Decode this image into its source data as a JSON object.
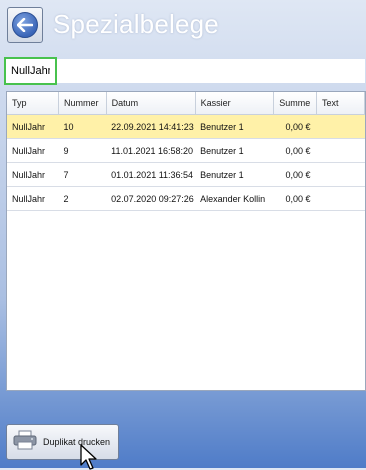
{
  "header": {
    "title": "Spezialbelege",
    "back_icon": "back-arrow-icon"
  },
  "filter": {
    "value": "NullJahr"
  },
  "table": {
    "columns": [
      "Typ",
      "Nummer",
      "Datum",
      "Kassier",
      "Summe",
      "Text"
    ],
    "rows": [
      {
        "typ": "NullJahr",
        "nummer": "10",
        "datum": "22.09.2021 14:41:23",
        "kassier": "Benutzer 1",
        "summe": "0,00 €",
        "text": "",
        "selected": true
      },
      {
        "typ": "NullJahr",
        "nummer": "9",
        "datum": "11.01.2021 16:58:20",
        "kassier": "Benutzer 1",
        "summe": "0,00 €",
        "text": ""
      },
      {
        "typ": "NullJahr",
        "nummer": "7",
        "datum": "01.01.2021 11:36:54",
        "kassier": "Benutzer 1",
        "summe": "0,00 €",
        "text": ""
      },
      {
        "typ": "NullJahr",
        "nummer": "2",
        "datum": "02.07.2020 09:27:26",
        "kassier": "Alexander Kollin",
        "summe": "0,00 €",
        "text": ""
      }
    ],
    "selected_row_color": "#fff1a8"
  },
  "footer": {
    "print_label": "Duplikat drucken",
    "print_icon": "printer-icon"
  }
}
